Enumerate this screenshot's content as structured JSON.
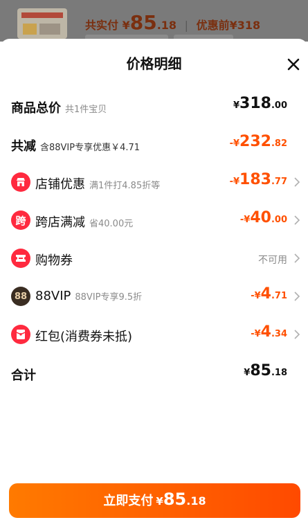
{
  "background": {
    "price_prefix": "共实付",
    "currency": "¥",
    "price_int": "85",
    "price_dec": ".18",
    "separator": "|",
    "before_label": "优惠前",
    "before_price": "¥318"
  },
  "sheet": {
    "title": "价格明细",
    "close_icon": "close-icon"
  },
  "rows": {
    "total": {
      "label": "商品总价",
      "sub": "共1件宝贝",
      "currency": "¥",
      "int": "318",
      "dec": ".00"
    },
    "reduce": {
      "label": "共减",
      "sub": "含88VIP专享优惠￥4.71",
      "currency": "-¥",
      "int": "232",
      "dec": ".82"
    },
    "store": {
      "label": "店铺优惠",
      "sub": "满1件打4.85折等",
      "currency": "-¥",
      "int": "183",
      "dec": ".77",
      "icon": "store-icon"
    },
    "cross": {
      "label": "跨店满减",
      "sub": "省40.00元",
      "currency": "-¥",
      "int": "40",
      "dec": ".00",
      "icon_text": "跨"
    },
    "coupon": {
      "label": "购物券",
      "status": "不可用",
      "icon": "coupon-icon"
    },
    "vip": {
      "label": "88VIP",
      "sub": "88VIP专享9.5折",
      "currency": "-¥",
      "int": "4",
      "dec": ".71",
      "icon_text": "88"
    },
    "redpacket": {
      "label": "红包(消费券未抵)",
      "currency": "-¥",
      "int": "4",
      "dec": ".34",
      "icon": "red-packet-icon"
    },
    "sum": {
      "label": "合计",
      "currency": "¥",
      "int": "85",
      "dec": ".18"
    }
  },
  "pay_button": {
    "label": "立即支付",
    "currency": "¥",
    "int": "85",
    "dec": ".18"
  },
  "colors": {
    "accent": "#ff5000",
    "icon_red": "#ff2a3f",
    "vip_dark": "#3a2d22"
  }
}
